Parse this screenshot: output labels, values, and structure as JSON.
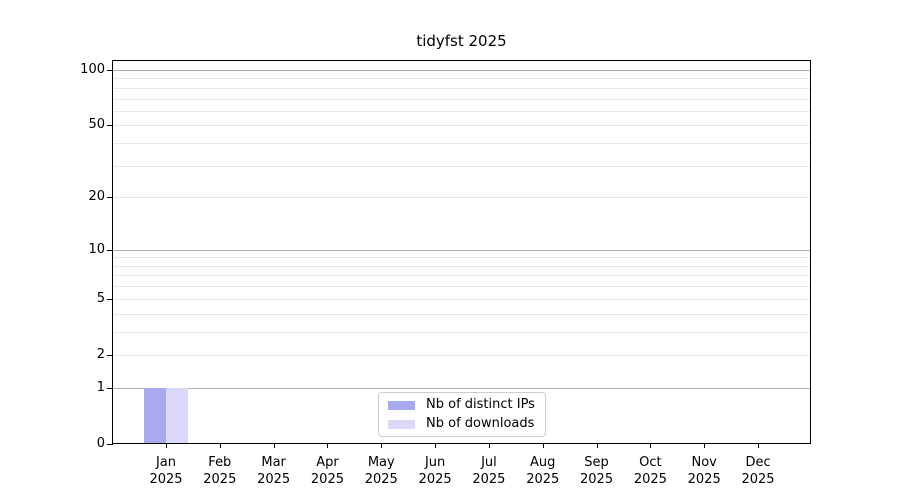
{
  "figure": {
    "title": "tidyfst 2025"
  },
  "chart_data": {
    "type": "bar",
    "title": "tidyfst 2025",
    "categories": [
      "Jan 2025",
      "Feb 2025",
      "Mar 2025",
      "Apr 2025",
      "May 2025",
      "Jun 2025",
      "Jul 2025",
      "Aug 2025",
      "Sep 2025",
      "Oct 2025",
      "Nov 2025",
      "Dec 2025"
    ],
    "series": [
      {
        "name": "Nb of distinct IPs",
        "color": "#a9a9f2",
        "values": [
          1,
          0,
          0,
          0,
          0,
          0,
          0,
          0,
          0,
          0,
          0,
          0
        ]
      },
      {
        "name": "Nb of downloads",
        "color": "#dadaf8",
        "values": [
          1,
          0,
          0,
          0,
          0,
          0,
          0,
          0,
          0,
          0,
          0,
          0
        ]
      }
    ],
    "xlabel": "",
    "ylabel": "",
    "y_axis": {
      "scale": "log1p",
      "tick_labels": [
        0,
        1,
        2,
        5,
        10,
        20,
        50,
        100
      ],
      "grid_major": [
        1,
        10,
        100
      ],
      "grid_minor": [
        2,
        3,
        4,
        5,
        6,
        7,
        8,
        9,
        20,
        30,
        40,
        50,
        60,
        70,
        80,
        90
      ],
      "range": [
        0,
        113
      ]
    },
    "grid": "horizontal",
    "legend_position": "lower center inside plot",
    "colors": {
      "grid_major": "#b0b0b0",
      "grid_minor": "#e9e9e9",
      "spine": "#000000",
      "background": "#ffffff"
    }
  }
}
